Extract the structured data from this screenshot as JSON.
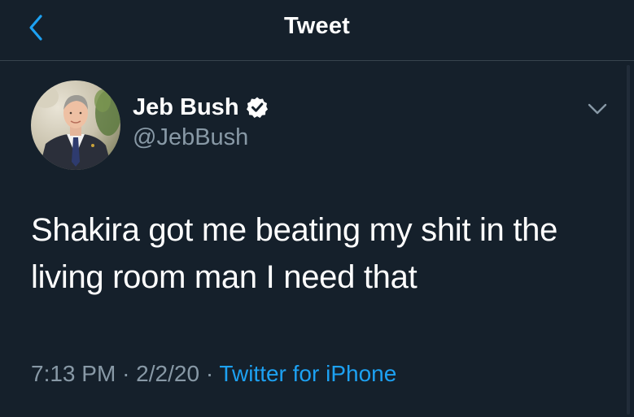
{
  "header": {
    "title": "Tweet",
    "back_icon": "chevron-left-icon"
  },
  "author": {
    "name": "Jeb Bush",
    "handle": "@JebBush",
    "verified": true,
    "verified_icon": "verified-badge-icon",
    "menu_icon": "chevron-down-icon"
  },
  "tweet": {
    "text": "Shakira got me beating my shit in the living room man I need that"
  },
  "meta": {
    "time": "7:13 PM",
    "separator": "·",
    "date": "2/2/20",
    "source": "Twitter for iPhone"
  },
  "colors": {
    "background": "#15202b",
    "accent": "#1da1f2",
    "secondary_text": "#8899a6",
    "divider": "#38444d"
  }
}
